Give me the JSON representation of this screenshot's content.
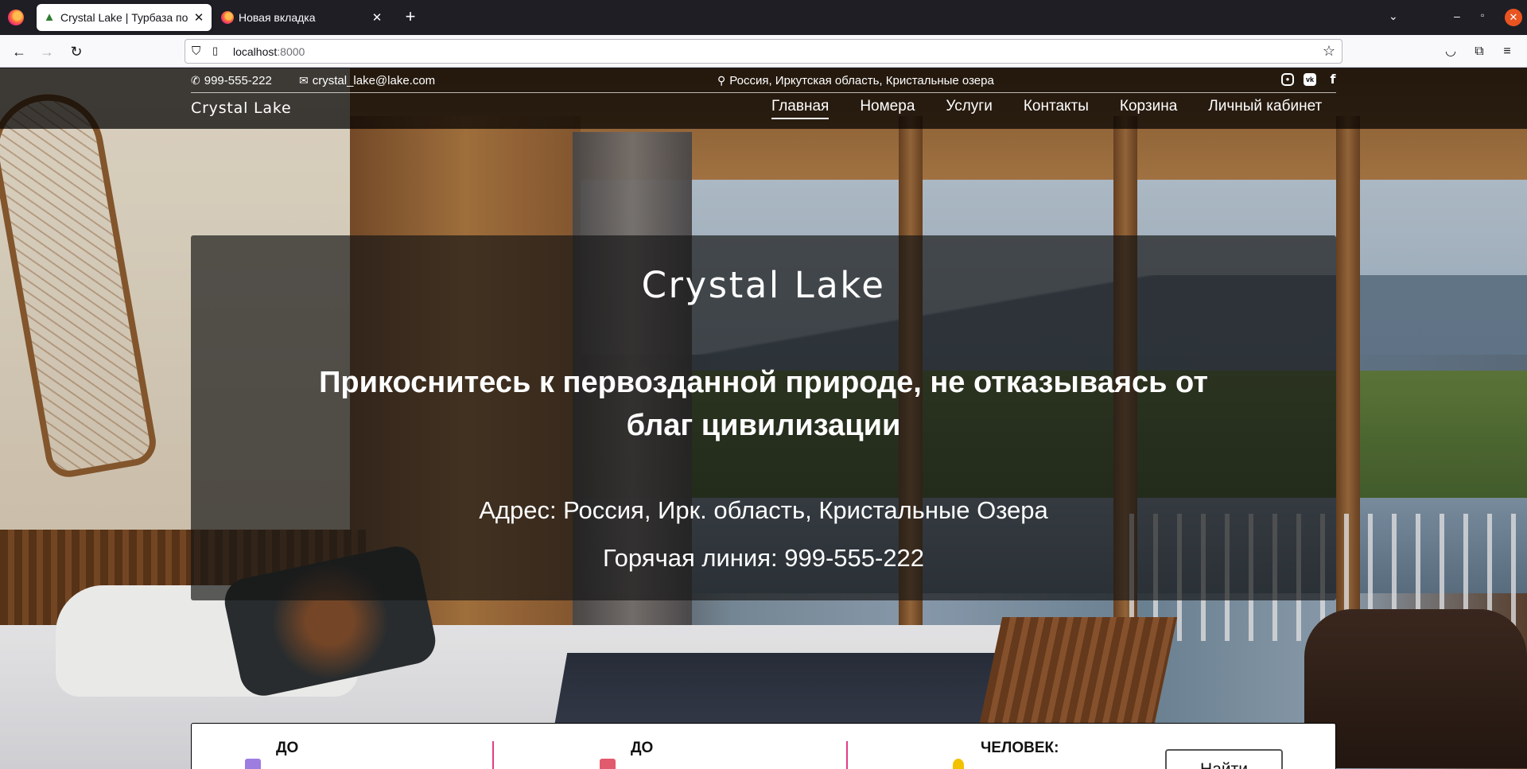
{
  "browser": {
    "tabs": [
      {
        "title": "Crystal Lake | Турбаза по",
        "active": true
      },
      {
        "title": "Новая вкладка",
        "active": false
      }
    ],
    "url_host": "localhost",
    "url_port": ":8000"
  },
  "site": {
    "topbar": {
      "phone": "999-555-222",
      "email": "crystal_lake@lake.com",
      "location": "Россия, Иркутская область, Кристальные озера"
    },
    "brand": "Crystal Lake",
    "menu": [
      "Главная",
      "Номера",
      "Услуги",
      "Контакты",
      "Корзина",
      "Личный кабинет"
    ],
    "active_menu": "Главная"
  },
  "hero": {
    "title": "Crystal Lake",
    "subtitle": "Прикоснитесь к первозданной природе, не отказываясь от благ цивилизации",
    "address": "Адрес: Россия, Ирк. область, Кристальные Озера",
    "hotline": "Горячая линия: 999-555-222"
  },
  "booking": {
    "field1_label": "ДО",
    "field2_label": "ДО",
    "field3_label": "ЧЕЛОВЕК:",
    "search_button": "Найти"
  },
  "colors": {
    "accent": "#e23d85",
    "calendar_icon_1": "#9d7de0",
    "calendar_icon_2": "#e25a6d",
    "person_icon": "#f2c200"
  }
}
